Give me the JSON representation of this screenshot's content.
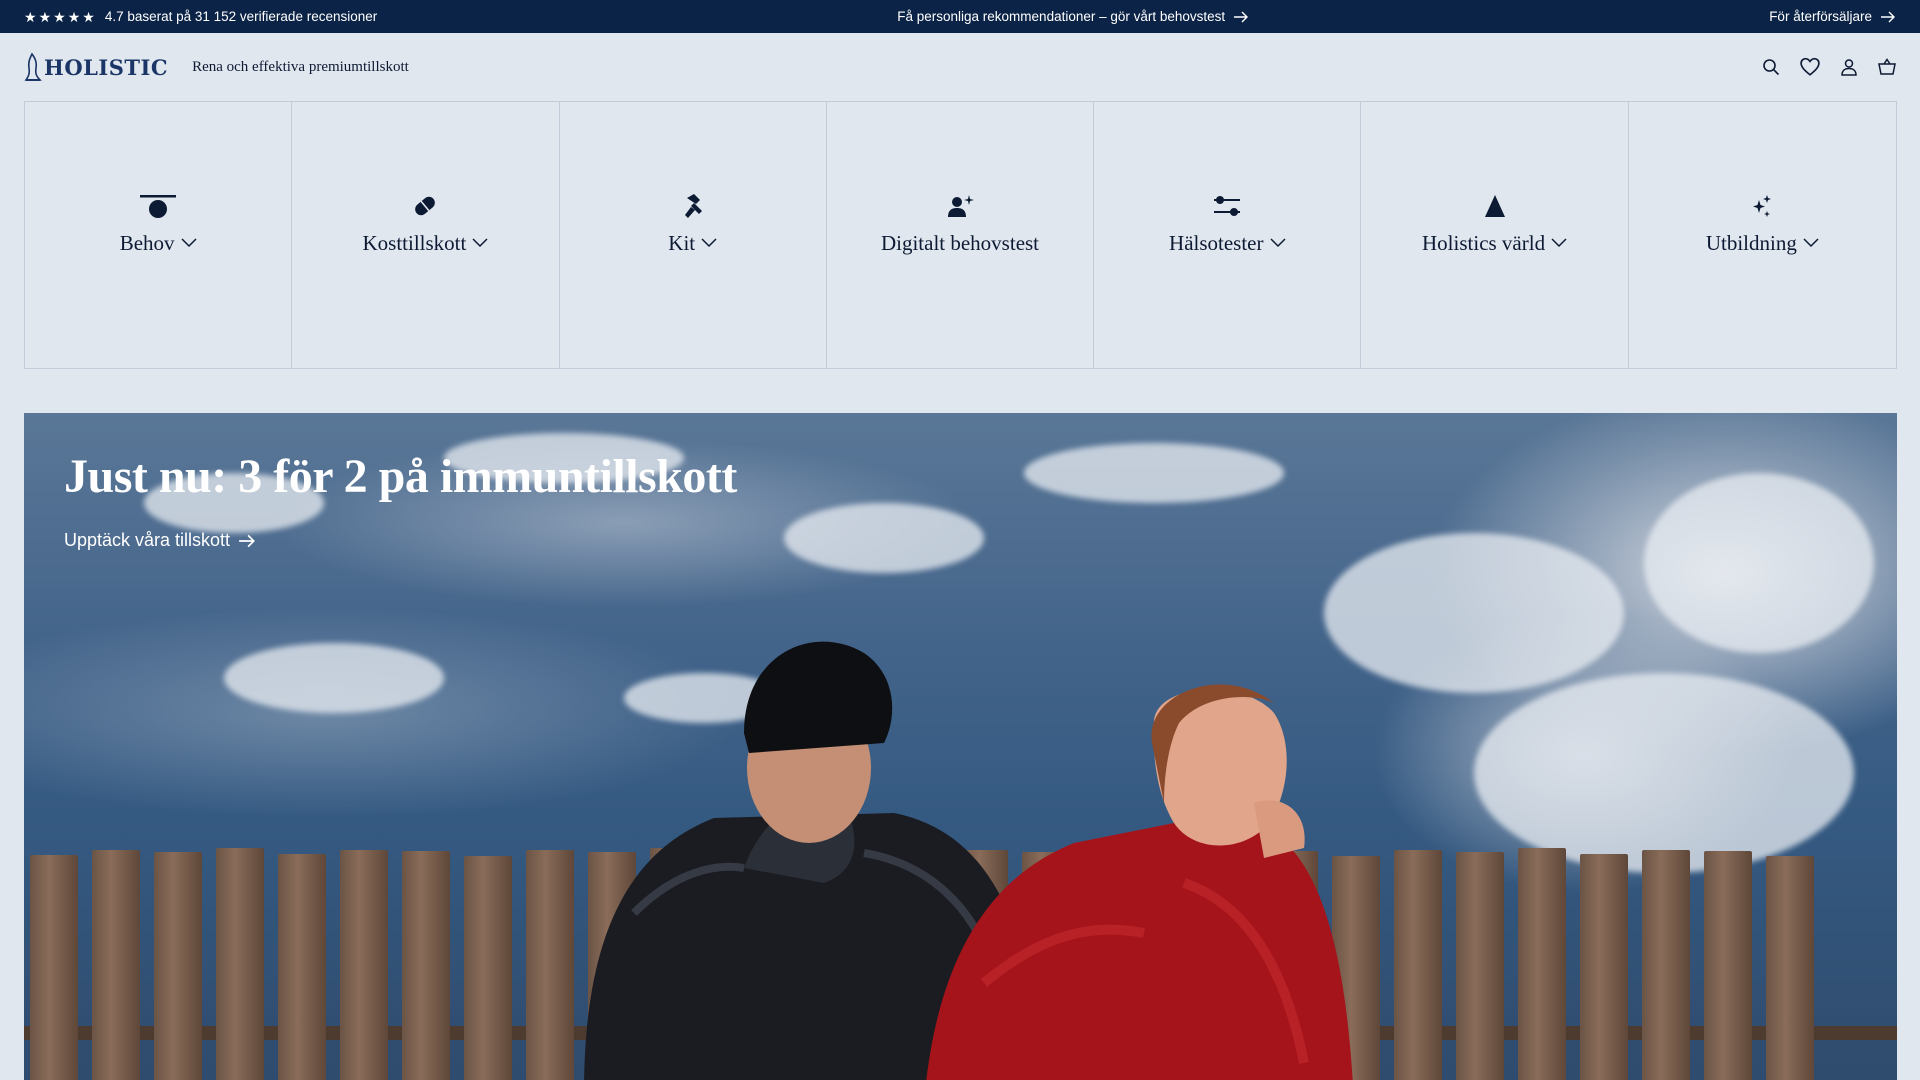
{
  "topbar": {
    "stars": [
      "★",
      "★",
      "★",
      "★",
      "★"
    ],
    "rating_text": "4.7 baserat på 31 152 verifierade recensioner",
    "promo_text": "Få personliga rekommendationer – gör vårt behovstest",
    "retailer_text": "För återförsäljare"
  },
  "header": {
    "logo_text": "HOLISTIC",
    "tagline": "Rena och effektiva premiumtillskott",
    "icons": [
      "search-icon",
      "heart-icon",
      "user-icon",
      "cart-icon"
    ]
  },
  "nav": {
    "items": [
      {
        "label": "Behov",
        "icon": "needs-icon",
        "has_dropdown": true
      },
      {
        "label": "Kosttillskott",
        "icon": "pill-icon",
        "has_dropdown": true
      },
      {
        "label": "Kit",
        "icon": "kit-icon",
        "has_dropdown": true
      },
      {
        "label": "Digitalt behovstest",
        "icon": "person-sparkle-icon",
        "has_dropdown": false
      },
      {
        "label": "Hälsotester",
        "icon": "sliders-icon",
        "has_dropdown": true
      },
      {
        "label": "Holistics värld",
        "icon": "mountain-icon",
        "has_dropdown": true
      },
      {
        "label": "Utbildning",
        "icon": "sparkle-icon",
        "has_dropdown": true
      }
    ]
  },
  "hero": {
    "title": "Just nu: 3 för 2 på immuntillskott",
    "link_text": "Upptäck våra tillskott"
  },
  "colors": {
    "topbar_bg": "#0b2346",
    "page_bg": "#e1e7ef",
    "logo": "#1b3566",
    "text": "#0d1a33"
  }
}
